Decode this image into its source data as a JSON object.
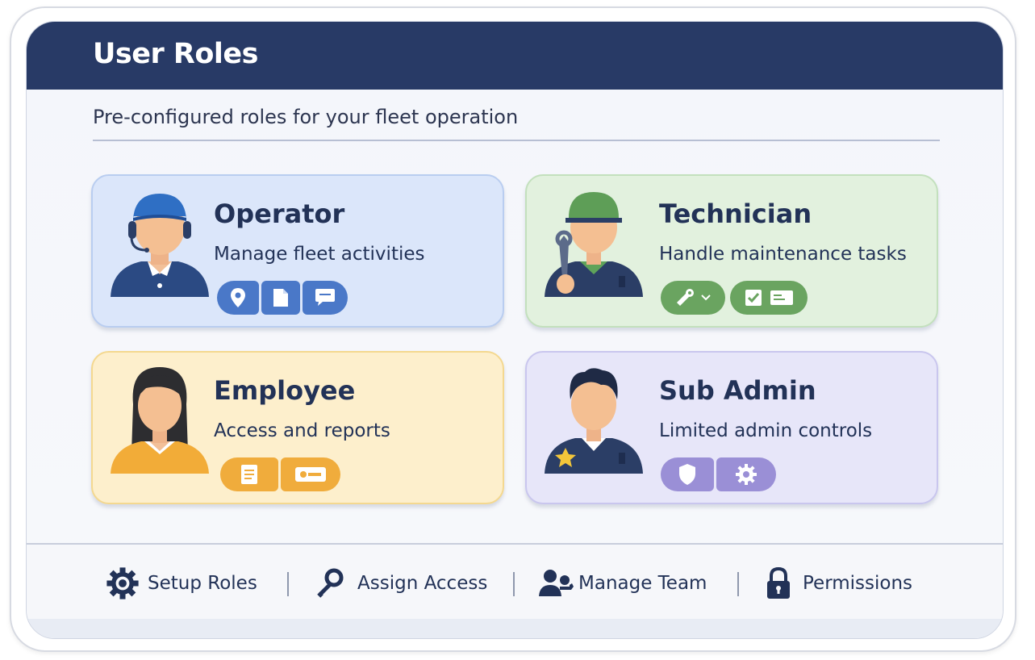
{
  "header": {
    "title": "User Roles"
  },
  "subtitle": "Pre-configured roles for your fleet operation",
  "roles": [
    {
      "title": "Operator",
      "description": "Manage fleet activities",
      "accent": "#4a78c8",
      "icons": [
        "location-pin-icon",
        "document-icon",
        "chat-icon"
      ]
    },
    {
      "title": "Technician",
      "description": "Handle maintenance tasks",
      "accent": "#6aa460",
      "icons": [
        "wrench-icon",
        "chevron-down-icon",
        "checkbox-icon",
        "id-card-icon"
      ]
    },
    {
      "title": "Employee",
      "description": "Access and reports",
      "accent": "#f0ac3c",
      "icons": [
        "report-icon",
        "key-card-icon"
      ]
    },
    {
      "title": "Sub Admin",
      "description": "Limited admin controls",
      "accent": "#9a8fd6",
      "icons": [
        "shield-icon",
        "gear-icon"
      ]
    }
  ],
  "footer": {
    "items": [
      {
        "label": "Setup Roles",
        "icon": "gear-icon"
      },
      {
        "label": "Assign Access",
        "icon": "key-icon"
      },
      {
        "label": "Manage Team",
        "icon": "team-icon"
      },
      {
        "label": "Permissions",
        "icon": "lock-icon"
      }
    ]
  },
  "colors": {
    "header_bg": "#283a66",
    "text_dark": "#223257"
  }
}
